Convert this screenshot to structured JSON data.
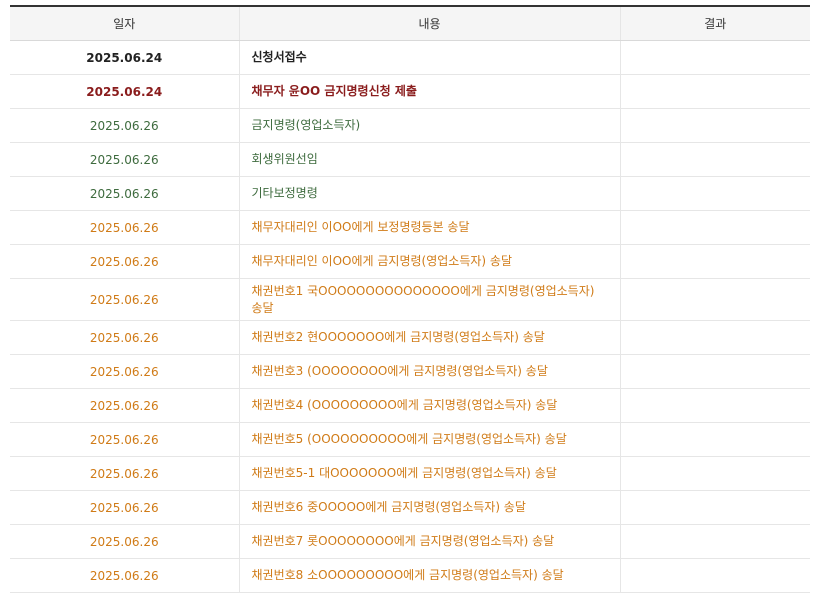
{
  "header": {
    "date": "일자",
    "content": "내용",
    "result": "결과"
  },
  "colors": {
    "black": "#222222",
    "darkred": "#8a1c1c",
    "green": "#3e6b3e",
    "orange": "#d07b17"
  },
  "rows": [
    {
      "date": "2025.06.24",
      "content": "신청서접수",
      "result": "",
      "color": "#222222",
      "bold": true
    },
    {
      "date": "2025.06.24",
      "content": "채무자 윤OO 금지명령신청 제출",
      "result": "",
      "color": "#8a1c1c",
      "bold": true
    },
    {
      "date": "2025.06.26",
      "content": "금지명령(영업소득자)",
      "result": "",
      "color": "#3e6b3e",
      "bold": false
    },
    {
      "date": "2025.06.26",
      "content": "회생위원선임",
      "result": "",
      "color": "#3e6b3e",
      "bold": false
    },
    {
      "date": "2025.06.26",
      "content": "기타보정명령",
      "result": "",
      "color": "#3e6b3e",
      "bold": false
    },
    {
      "date": "2025.06.26",
      "content": "채무자대리인 이OO에게 보정명령등본 송달",
      "result": "",
      "color": "#d07b17",
      "bold": false
    },
    {
      "date": "2025.06.26",
      "content": "채무자대리인 이OO에게 금지명령(영업소득자) 송달",
      "result": "",
      "color": "#d07b17",
      "bold": false
    },
    {
      "date": "2025.06.26",
      "content": "채권번호1 국OOOOOOOOOOOOOOO에게 금지명령(영업소득자) 송달",
      "result": "",
      "color": "#d07b17",
      "bold": false
    },
    {
      "date": "2025.06.26",
      "content": "채권번호2 현OOOOOOO에게 금지명령(영업소득자) 송달",
      "result": "",
      "color": "#d07b17",
      "bold": false
    },
    {
      "date": "2025.06.26",
      "content": "채권번호3 (OOOOOOOO에게 금지명령(영업소득자) 송달",
      "result": "",
      "color": "#d07b17",
      "bold": false
    },
    {
      "date": "2025.06.26",
      "content": "채권번호4 (OOOOOOOOO에게 금지명령(영업소득자) 송달",
      "result": "",
      "color": "#d07b17",
      "bold": false
    },
    {
      "date": "2025.06.26",
      "content": "채권번호5 (OOOOOOOOOO에게 금지명령(영업소득자) 송달",
      "result": "",
      "color": "#d07b17",
      "bold": false
    },
    {
      "date": "2025.06.26",
      "content": "채권번호5-1 대OOOOOOO에게 금지명령(영업소득자) 송달",
      "result": "",
      "color": "#d07b17",
      "bold": false
    },
    {
      "date": "2025.06.26",
      "content": "채권번호6 중OOOOO에게 금지명령(영업소득자) 송달",
      "result": "",
      "color": "#d07b17",
      "bold": false
    },
    {
      "date": "2025.06.26",
      "content": "채권번호7 롯OOOOOOOO에게 금지명령(영업소득자) 송달",
      "result": "",
      "color": "#d07b17",
      "bold": false
    },
    {
      "date": "2025.06.26",
      "content": "채권번호8 소OOOOOOOOO에게 금지명령(영업소득자) 송달",
      "result": "",
      "color": "#d07b17",
      "bold": false
    }
  ]
}
